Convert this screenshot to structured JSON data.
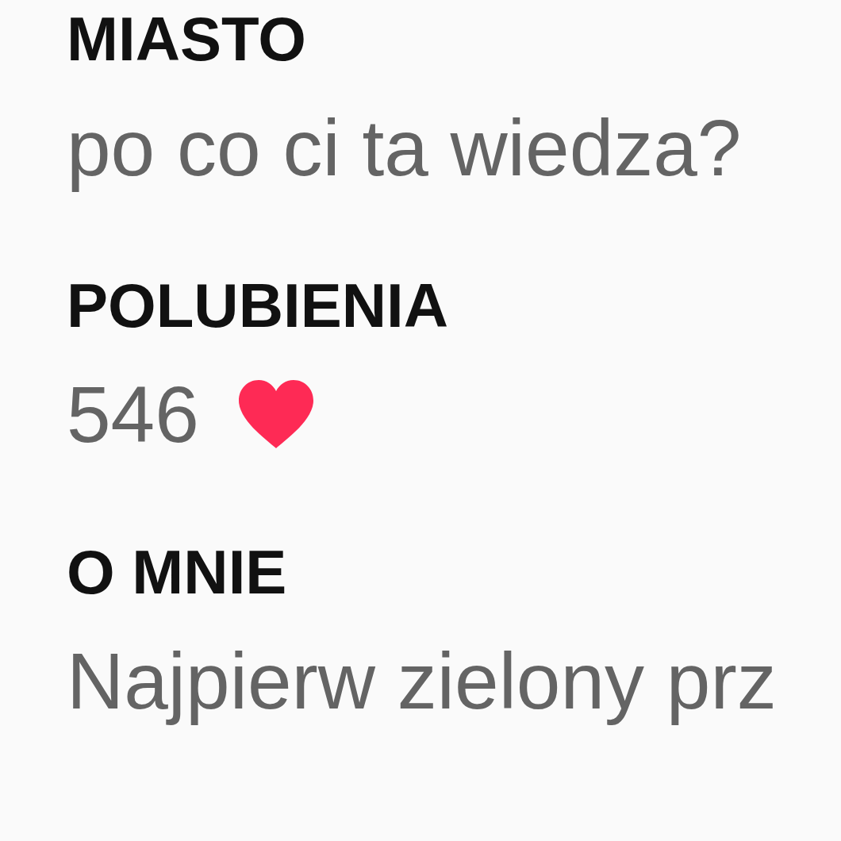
{
  "fields": [
    {
      "label": "MIASTO",
      "value": "po co ci ta wiedza?",
      "kind": "text"
    },
    {
      "label": "POLUBIENIA",
      "value": "546",
      "kind": "likes"
    },
    {
      "label": "O MNIE",
      "value": "Najpierw zielony prz",
      "kind": "text"
    }
  ]
}
